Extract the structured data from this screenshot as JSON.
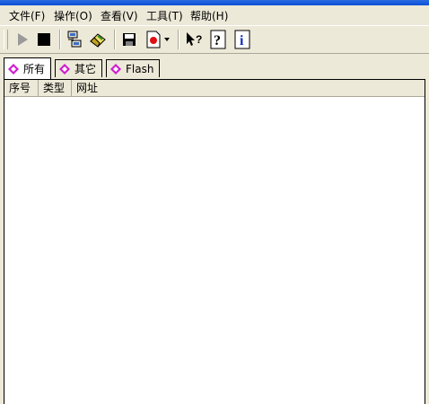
{
  "menu": {
    "items": [
      {
        "label": "文件(F)"
      },
      {
        "label": "操作(O)"
      },
      {
        "label": "查看(V)"
      },
      {
        "label": "工具(T)"
      },
      {
        "label": "帮助(H)"
      }
    ]
  },
  "toolbar": {
    "buttons": [
      "play-icon",
      "stop-icon",
      "network-icon",
      "eraser-icon",
      "save-icon",
      "export-icon",
      "dropdown-arrow-icon",
      "whats-this-icon",
      "help-icon",
      "info-icon"
    ]
  },
  "tabs": [
    {
      "label": "所有",
      "active": true
    },
    {
      "label": "其它",
      "active": false
    },
    {
      "label": "Flash",
      "active": false
    }
  ],
  "table": {
    "columns": [
      "序号",
      "类型",
      "网址"
    ]
  },
  "colors": {
    "tab_icon": "#d01cd0",
    "accent": "#0b4fd6"
  }
}
